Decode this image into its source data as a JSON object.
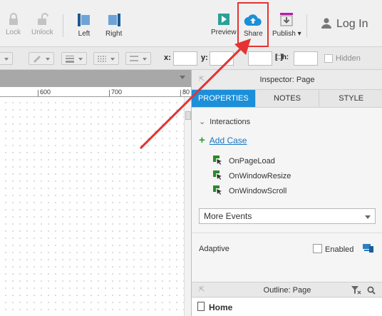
{
  "toolbar": {
    "lock": "Lock",
    "unlock": "Unlock",
    "left": "Left",
    "right": "Right",
    "preview": "Preview",
    "share": "Share",
    "publish": "Publish ▾",
    "login": "Log In"
  },
  "formatbar": {
    "x_label": "x:",
    "y_label": "y:",
    "h_label": "h:",
    "hidden": "Hidden"
  },
  "ruler": {
    "labels": [
      "600",
      "700",
      "80"
    ]
  },
  "inspector": {
    "title": "Inspector: Page",
    "tabs": [
      "PROPERTIES",
      "NOTES",
      "STYLE"
    ],
    "active_tab": "PROPERTIES",
    "interactions_label": "Interactions",
    "add_case": "Add Case",
    "events": [
      "OnPageLoad",
      "OnWindowResize",
      "OnWindowScroll"
    ],
    "more_events": "More Events",
    "adaptive_label": "Adaptive",
    "enabled_label": "Enabled",
    "enabled_checked": false
  },
  "outline": {
    "title": "Outline: Page",
    "root": "Home"
  },
  "colors": {
    "accent": "#1b8fd9",
    "annotation": "#e53333",
    "link": "#1576c2",
    "add": "#2ea12e"
  },
  "icons": [
    "lock-icon",
    "unlock-icon",
    "align-left-icon",
    "align-right-icon",
    "preview-icon",
    "share-cloud-icon",
    "publish-icon",
    "user-icon",
    "pin-icon",
    "filter-icon",
    "search-icon",
    "page-icon",
    "event-cursor-icon",
    "adaptive-icon"
  ]
}
